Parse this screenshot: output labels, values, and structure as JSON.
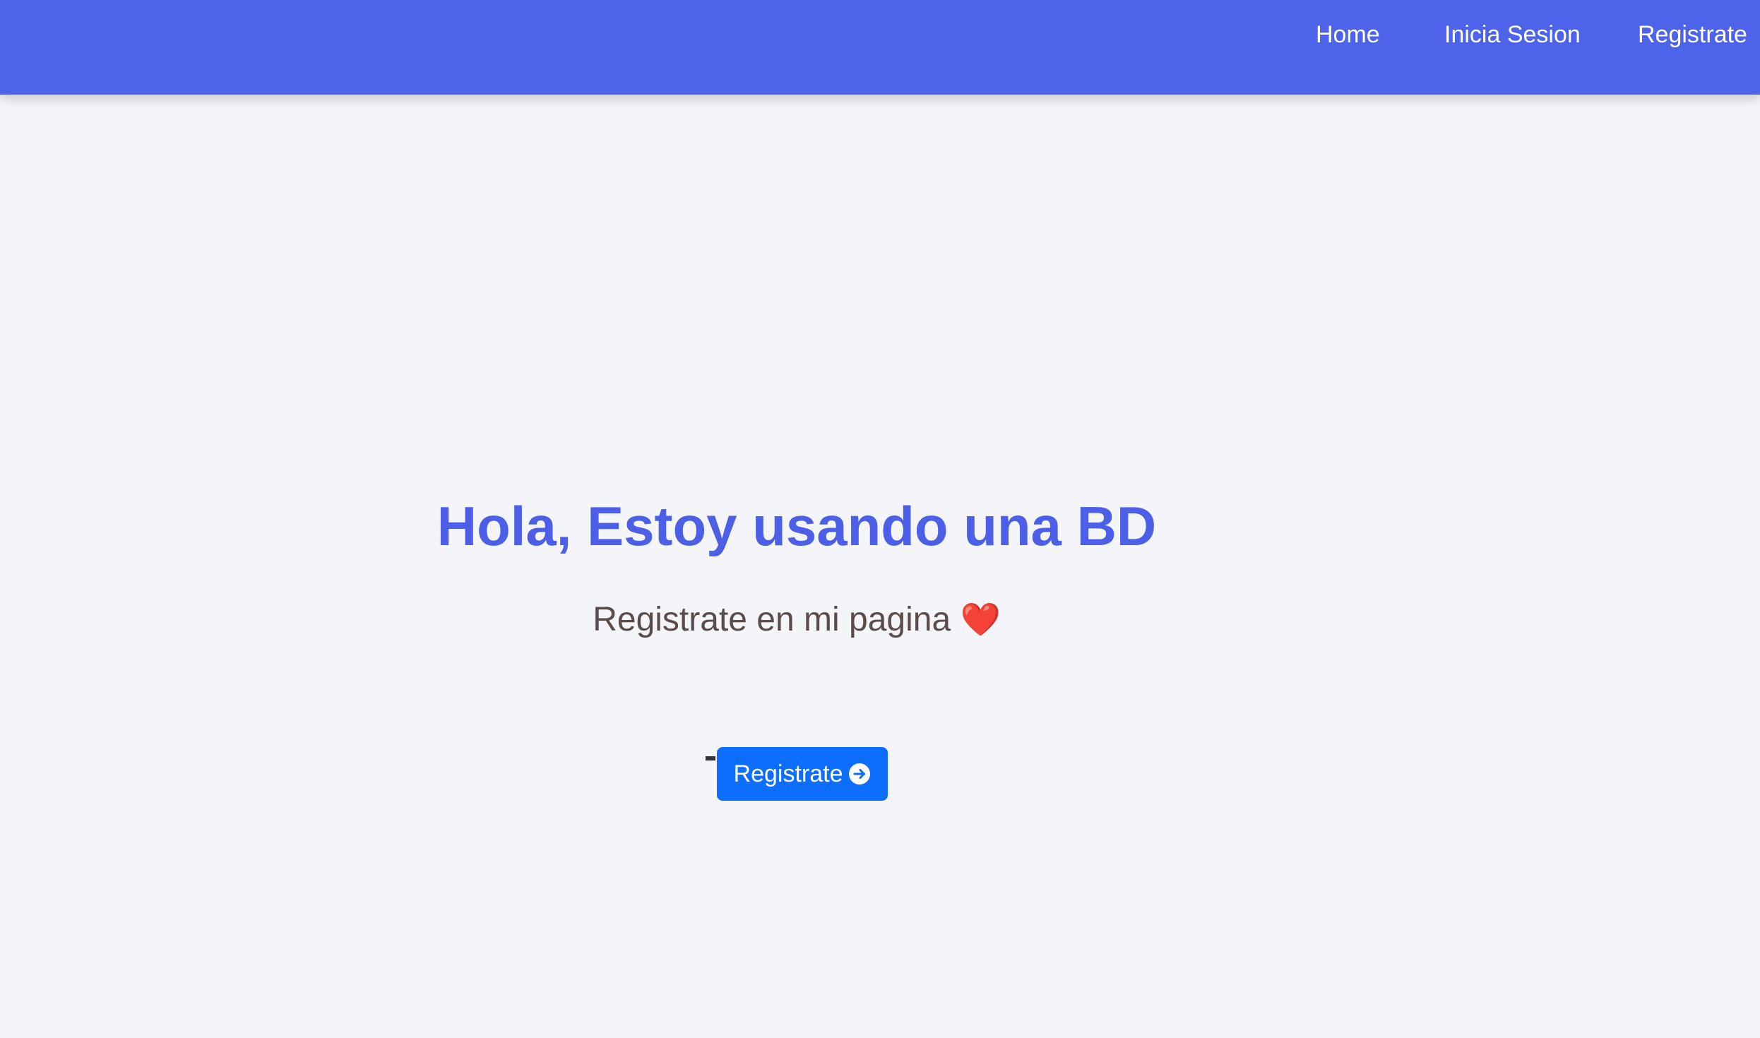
{
  "navbar": {
    "background_color": "#4c63ea",
    "links": [
      {
        "label": "Home"
      },
      {
        "label": "Inicia Sesion"
      },
      {
        "label": "Registrate"
      }
    ]
  },
  "hero": {
    "title": "Hola, Estoy usando una BD",
    "subtitle": "Registrate en mi pagina",
    "subtitle_emoji": "❤️",
    "title_color": "#4c5fe6",
    "subtitle_color": "#5a4c4a",
    "button": {
      "label": "Registrate",
      "icon": "arrow-right-circle-icon",
      "color": "#0d6efd"
    }
  }
}
